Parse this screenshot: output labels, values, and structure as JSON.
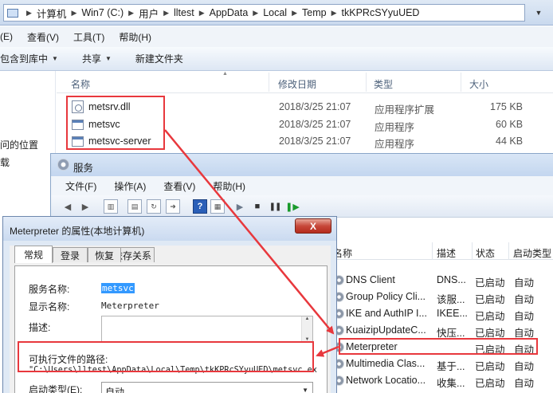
{
  "explorer": {
    "breadcrumbs": [
      "计算机",
      "Win7 (C:)",
      "用户",
      "lltest",
      "AppData",
      "Local",
      "Temp",
      "tkKPRcSYyuUED"
    ],
    "menu": [
      "(E)",
      "查看(V)",
      "工具(T)",
      "帮助(H)"
    ],
    "commands": {
      "include": "包含到库中",
      "share": "共享",
      "new_folder": "新建文件夹"
    },
    "nav": [
      "问的位置",
      "载"
    ],
    "columns": {
      "name": "名称",
      "date": "修改日期",
      "type": "类型",
      "size": "大小"
    },
    "files": [
      {
        "name": "metsrv.dll",
        "date": "2018/3/25 21:07",
        "type": "应用程序扩展",
        "size": "175 KB",
        "icon": "dll-icon"
      },
      {
        "name": "metsvc",
        "date": "2018/3/25 21:07",
        "type": "应用程序",
        "size": "60 KB",
        "icon": "exe-icon"
      },
      {
        "name": "metsvc-server",
        "date": "2018/3/25 21:07",
        "type": "应用程序",
        "size": "44 KB",
        "icon": "exe-icon"
      }
    ]
  },
  "services": {
    "title": "服务",
    "menu": [
      "文件(F)",
      "操作(A)",
      "查看(V)",
      "帮助(H)"
    ],
    "columns": {
      "name": "名称",
      "desc": "描述",
      "status": "状态",
      "startup": "启动类型"
    },
    "rows": [
      {
        "name": "DNS Client",
        "desc": "DNS...",
        "status": "已启动",
        "startup": "自动"
      },
      {
        "name": "Group Policy Cli...",
        "desc": "该服...",
        "status": "已启动",
        "startup": "自动"
      },
      {
        "name": "IKE and AuthIP I...",
        "desc": "IKEE...",
        "status": "已启动",
        "startup": "自动"
      },
      {
        "name": "KuaizipUpdateC...",
        "desc": "快压...",
        "status": "已启动",
        "startup": "自动"
      },
      {
        "name": "Meterpreter",
        "desc": "",
        "status": "已启动",
        "startup": "自动"
      },
      {
        "name": "Multimedia Clas...",
        "desc": "基于...",
        "status": "已启动",
        "startup": "自动"
      },
      {
        "name": "Network Locatio...",
        "desc": "收集...",
        "status": "已启动",
        "startup": "自动"
      }
    ]
  },
  "dialog": {
    "title": "Meterpreter 的属性(本地计算机)",
    "close": "X",
    "tabs": [
      "常规",
      "登录",
      "恢复",
      "依存关系"
    ],
    "service_name_label": "服务名称:",
    "service_name": "metsvc",
    "display_name_label": "显示名称:",
    "display_name": "Meterpreter",
    "description_label": "描述:",
    "path_label": "可执行文件的路径:",
    "path": "\"C:\\Users\\lltest\\AppData\\Local\\Temp\\tkKPRcSYyuUED\\metsvc.exe\"",
    "startup_label": "启动类型(E):",
    "startup_value": "自动"
  },
  "annotation_color": "#e8383d"
}
